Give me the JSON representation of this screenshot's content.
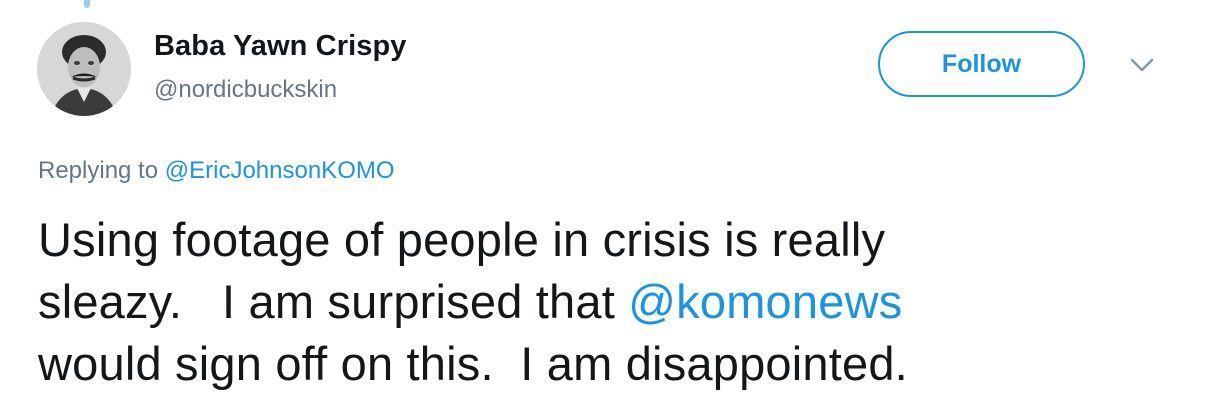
{
  "user": {
    "display_name": "Baba Yawn Crispy",
    "handle": "@nordicbuckskin"
  },
  "actions": {
    "follow_label": "Follow",
    "menu_icon": "chevron-down-icon"
  },
  "reply": {
    "prefix": "Replying to ",
    "mention": "@EricJohnsonKOMO"
  },
  "tweet": {
    "text_part1": "Using footage of people in crisis is really\nsleazy.   I am surprised that ",
    "mention": "@komonews",
    "text_part2": "\nwould sign off on this.  I am disappointed."
  },
  "colors": {
    "link": "#1b95e0",
    "secondary_text": "#657786",
    "primary_text": "#14171a"
  }
}
